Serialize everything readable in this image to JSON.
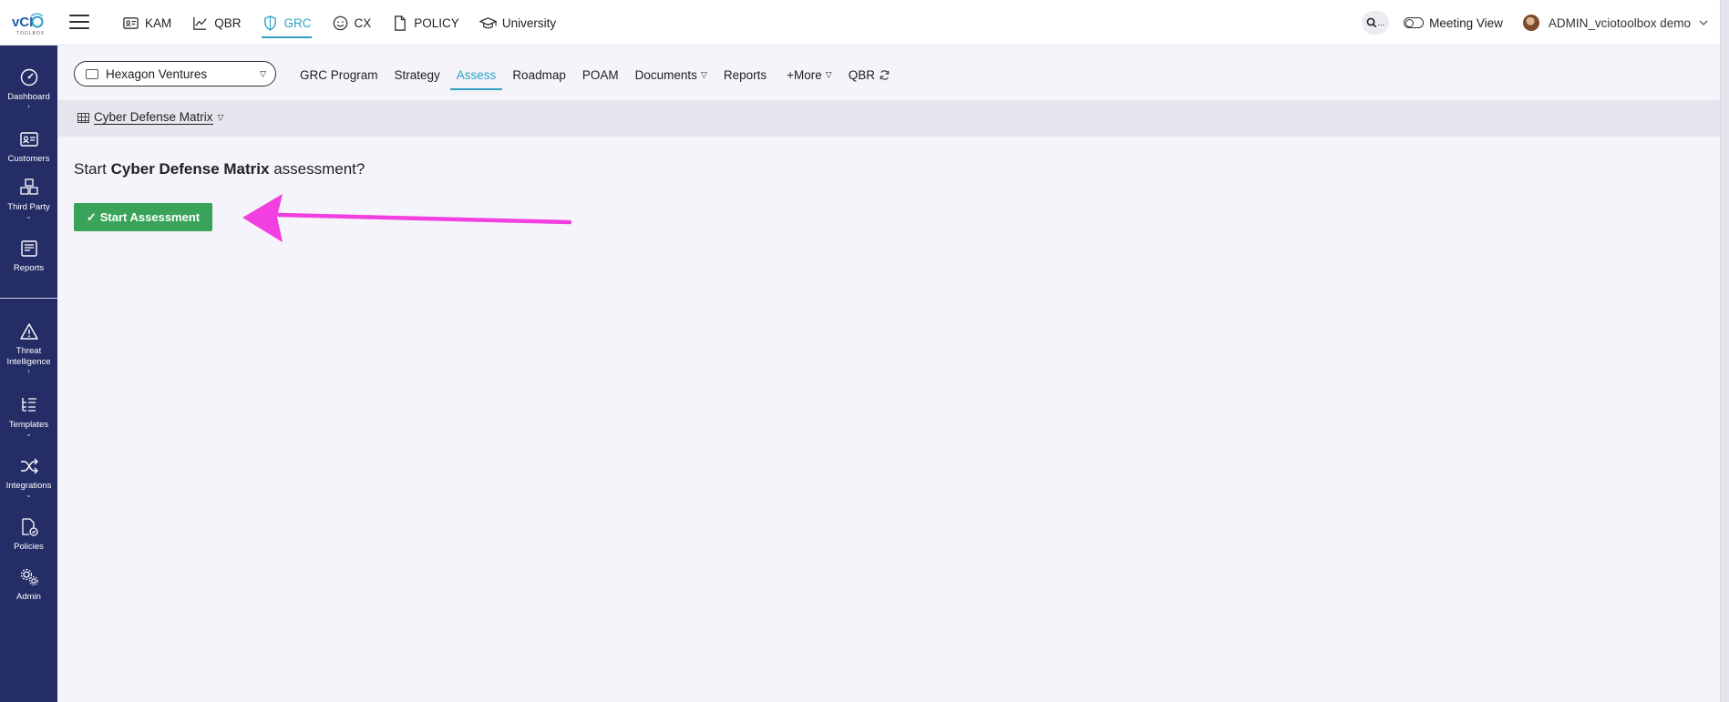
{
  "brand": {
    "logo_text": "vCIO",
    "logo_sub": "TOOLBOX"
  },
  "topnav": [
    {
      "label": "KAM",
      "icon": "id-card-icon",
      "active": false
    },
    {
      "label": "QBR",
      "icon": "line-chart-icon",
      "active": false
    },
    {
      "label": "GRC",
      "icon": "shield-icon",
      "active": true
    },
    {
      "label": "CX",
      "icon": "smiley-icon",
      "active": false
    },
    {
      "label": "POLICY",
      "icon": "document-icon",
      "active": false
    },
    {
      "label": "University",
      "icon": "graduation-cap-icon",
      "active": false
    }
  ],
  "topright": {
    "search_suffix": "...",
    "meeting_view": "Meeting View",
    "username": "ADMIN_vciotoolbox demo"
  },
  "sidebar": [
    {
      "label": "Dashboard",
      "caret": "›",
      "icon": "gauge-icon"
    },
    {
      "label": "Customers",
      "caret": "›",
      "icon": "id-card-icon"
    },
    {
      "label": "Third Party",
      "caret": "⌄",
      "icon": "boxes-icon"
    },
    {
      "label": "Reports",
      "caret": "⌄",
      "icon": "reports-icon"
    },
    {
      "label": "Threat Intelligence",
      "caret": "›",
      "icon": "warning-icon"
    },
    {
      "label": "Templates",
      "caret": "⌄",
      "icon": "list-tree-icon"
    },
    {
      "label": "Integrations",
      "caret": "⌄",
      "icon": "shuffle-icon"
    },
    {
      "label": "Policies",
      "caret": "›",
      "icon": "policy-file-icon"
    },
    {
      "label": "Admin",
      "caret": "⌄",
      "icon": "gears-icon"
    }
  ],
  "company_selector": {
    "value": "Hexagon Ventures"
  },
  "tabs": [
    {
      "label": "GRC Program",
      "active": false,
      "dropdown": false
    },
    {
      "label": "Strategy",
      "active": false,
      "dropdown": false
    },
    {
      "label": "Assess",
      "active": true,
      "dropdown": false
    },
    {
      "label": "Roadmap",
      "active": false,
      "dropdown": false
    },
    {
      "label": "POAM",
      "active": false,
      "dropdown": false
    },
    {
      "label": "Documents",
      "active": false,
      "dropdown": true
    },
    {
      "label": "Reports",
      "active": false,
      "dropdown": false
    },
    {
      "label": "+More",
      "active": false,
      "dropdown": true
    },
    {
      "label": "QBR",
      "active": false,
      "dropdown": false,
      "refresh": true
    }
  ],
  "framework": {
    "label": "Cyber Defense Matrix"
  },
  "prompt": {
    "before": "Start ",
    "framework": "Cyber Defense Matrix",
    "after": " assessment?"
  },
  "start_button": {
    "label": "Start Assessment",
    "check": "✓"
  },
  "colors": {
    "sidebar": "#242d66",
    "accent": "#2ea0c4",
    "start_button": "#3aa35a",
    "annotation_arrow": "#f23fe0"
  }
}
